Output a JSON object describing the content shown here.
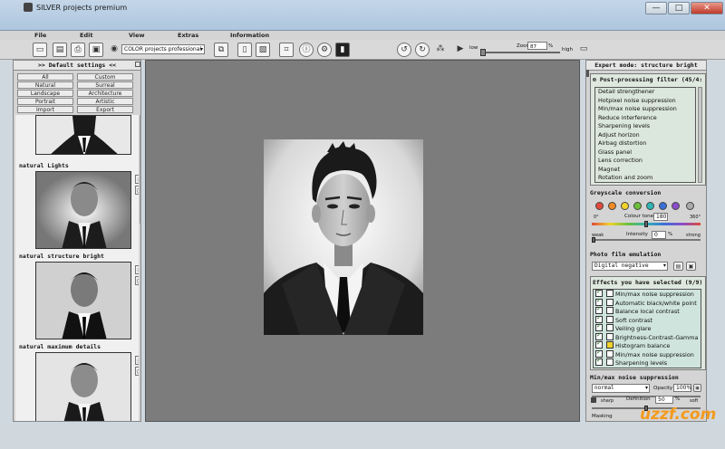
{
  "window": {
    "title": "SILVER projects premium",
    "minimize": "—",
    "maximize": "□",
    "close": "✕"
  },
  "menu": [
    "File",
    "Edit",
    "View",
    "Extras",
    "Information"
  ],
  "toolbar": {
    "preset_select": "COLOR projects professional",
    "low_label": "low",
    "high_label": "high",
    "zoom_label": "Zoom",
    "zoom_value": "87"
  },
  "left_panel": {
    "title": ">> Default settings <<",
    "categories": [
      "All",
      "Custom",
      "Natural",
      "Surreal",
      "Landscape",
      "Architecture",
      "Portrait",
      "Artistic",
      "Import",
      "Export"
    ],
    "presets": [
      "natural Lights",
      "natural structure bright",
      "natural maximum details"
    ]
  },
  "right_panel": {
    "mode_title": "Expert mode: structure bright",
    "postproc_title": "Post-processing filter (45/4:",
    "postproc_items": [
      "Detail strengthener",
      "Hotpixel noise suppression",
      "Min/max noise suppression",
      "Reduce interference",
      "Sharpening levels",
      "Adjust horizon",
      "Airbag distortion",
      "Glass panel",
      "Lens correction",
      "Magnet",
      "Rotation and zoom"
    ],
    "greyscale_title": "Greyscale conversion",
    "greyscale_dot_colors": [
      "#e24a3b",
      "#f08a24",
      "#f2d32b",
      "#6bbf3b",
      "#2fb5b5",
      "#3a6fd8",
      "#8b4cc9"
    ],
    "colour_tone_label": "Colour tone",
    "colour_tone_value": "180",
    "deg_min": "0°",
    "deg_max": "360°",
    "weak_label": "weak",
    "strong_label": "strong",
    "intensity_label": "Intensity",
    "intensity_value": "0",
    "pct": "%",
    "film_title": "Photo film emulation",
    "film_value": "Digital negative",
    "effects_title": "Effects you have selected (9/9)",
    "effects": [
      "Min/max noise suppression",
      "Automatic black/white point",
      "Balance local contrast",
      "Soft contrast",
      "Veiling glare",
      "Brightness-Contrast-Gamma",
      "Histogram balance",
      "Min/max noise suppression",
      "Sharpening levels"
    ],
    "detail_title": "Min/max noise suppression",
    "mode_value": "normal",
    "opacity_label": "Opacity",
    "opacity_value": "100%",
    "sharp_label": "sharp",
    "soft_label": "soft",
    "definition_label": "Definition",
    "definition_value": "50",
    "masking_label": "Masking"
  },
  "watermark": "uzzf.com"
}
